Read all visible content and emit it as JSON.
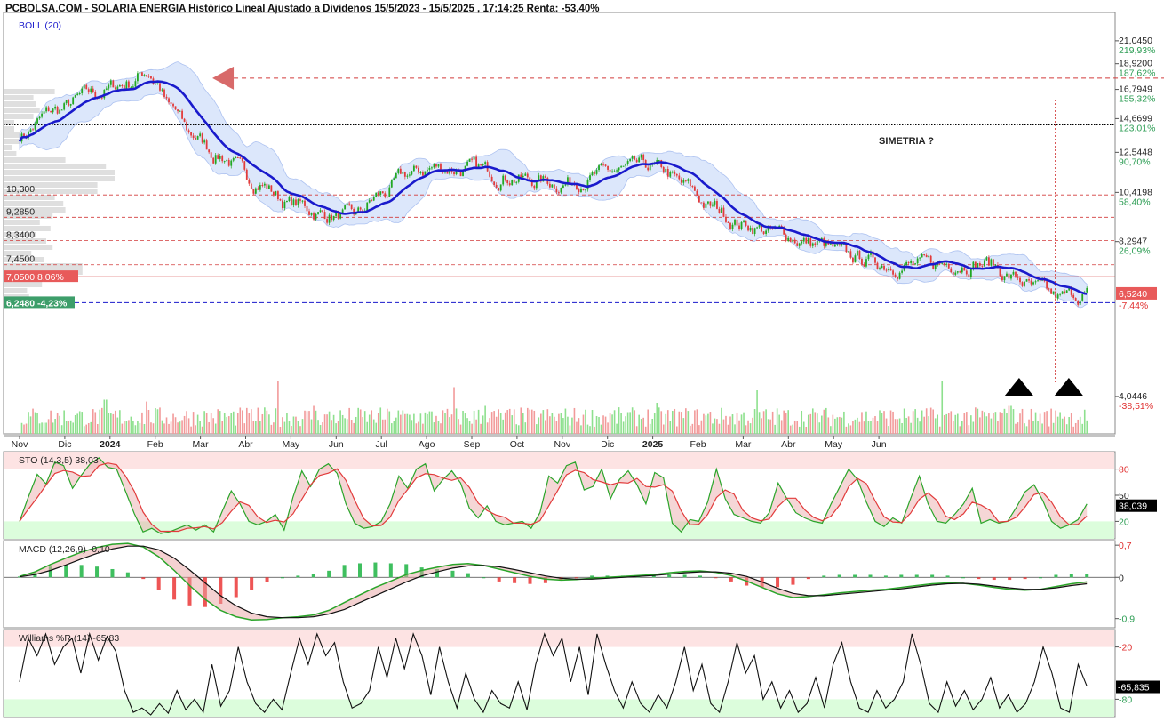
{
  "header": {
    "title": "PCBOLSA.COM - SOLARIA ENERGIA Histórico Lineal Ajustado a Dividenos 15/5/2023 - 15/5/2025 , 17:14:25 Renta: -53,40%"
  },
  "colors": {
    "up": "#22a822",
    "down": "#e23b3b",
    "boll_mid": "#1a1acc",
    "boll_band": "#dbe6fb",
    "overbought_zone": "#fde3e3",
    "oversold_zone": "#dcfddc",
    "badge_red": "#e85a5a",
    "badge_green": "#3d9e6a",
    "arrow": "#e03030"
  },
  "chart_data": [
    {
      "type": "line",
      "name": "price",
      "indicator_label": "BOLL (20)",
      "y_scale": "log",
      "ylim": [
        3.4,
        24.0
      ],
      "x_ticks": [
        "Nov",
        "Dic",
        "2024",
        "Feb",
        "Mar",
        "Abr",
        "May",
        "Jun",
        "Jul",
        "Ago",
        "Sep",
        "Oct",
        "Nov",
        "Dic",
        "2025",
        "Feb",
        "Mar",
        "Abr",
        "May",
        "Jun"
      ],
      "x_tick_bold": [
        "2024",
        "2025"
      ],
      "y_ticks": [
        {
          "price": "21,0450",
          "pct": "219,93%"
        },
        {
          "price": "18,9200",
          "pct": "187,62%"
        },
        {
          "price": "16,7949",
          "pct": "155,32%"
        },
        {
          "price": "14,6699",
          "pct": "123,01%"
        },
        {
          "price": "12,5448",
          "pct": "90,70%"
        },
        {
          "price": "10,4198",
          "pct": "58,40%"
        },
        {
          "price": "8,2947",
          "pct": "26,09%"
        },
        {
          "price": "4,0446",
          "pct": "-38,51%"
        }
      ],
      "y_tick_values": [
        21.045,
        18.92,
        16.7949,
        14.6699,
        12.5448,
        10.4198,
        8.2947,
        4.0446
      ],
      "current_price_label": "6,5240",
      "current_pct_label": "-7,44%",
      "current_price": 6.524,
      "ref_lines": [
        {
          "label": "10,300",
          "value": 10.3
        },
        {
          "label": "9,2850",
          "value": 9.285
        },
        {
          "label": "8,3400",
          "value": 8.34
        },
        {
          "label": "7,4500",
          "value": 7.45
        }
      ],
      "badge_upper": {
        "label": "7,0500  8,06%",
        "value": 7.05
      },
      "badge_lower": {
        "label": "6,2480  -4,23%",
        "value": 6.248
      },
      "black_dotted_line": 14.25,
      "annotation_text": "SIMETRIA ?",
      "anchors": [
        {
          "m": 0,
          "v": 13.6
        },
        {
          "m": 0.8,
          "v": 15.2
        },
        {
          "m": 1.6,
          "v": 16.4
        },
        {
          "m": 2.4,
          "v": 17.3
        },
        {
          "m": 2.85,
          "v": 18.3
        },
        {
          "m": 3.0,
          "v": 17.5
        },
        {
          "m": 3.35,
          "v": 15.3
        },
        {
          "m": 3.8,
          "v": 13.6
        },
        {
          "m": 4.4,
          "v": 12.4
        },
        {
          "m": 5.2,
          "v": 11.0
        },
        {
          "m": 6.0,
          "v": 9.9
        },
        {
          "m": 6.8,
          "v": 9.4
        },
        {
          "m": 7.4,
          "v": 9.3
        },
        {
          "m": 8.0,
          "v": 10.3
        },
        {
          "m": 8.6,
          "v": 11.3
        },
        {
          "m": 9.2,
          "v": 11.7
        },
        {
          "m": 10.0,
          "v": 11.6
        },
        {
          "m": 10.7,
          "v": 11.3
        },
        {
          "m": 11.4,
          "v": 11.0
        },
        {
          "m": 12.0,
          "v": 10.9
        },
        {
          "m": 12.6,
          "v": 11.2
        },
        {
          "m": 13.3,
          "v": 11.5
        },
        {
          "m": 13.8,
          "v": 11.7
        },
        {
          "m": 14.2,
          "v": 11.5
        },
        {
          "m": 14.7,
          "v": 10.7
        },
        {
          "m": 15.3,
          "v": 9.7
        },
        {
          "m": 16.0,
          "v": 9.0
        },
        {
          "m": 16.8,
          "v": 8.6
        },
        {
          "m": 17.6,
          "v": 8.2
        },
        {
          "m": 18.4,
          "v": 7.7
        },
        {
          "m": 19.2,
          "v": 7.5
        },
        {
          "m": 20.0,
          "v": 7.4
        },
        {
          "m": 20.8,
          "v": 7.55
        },
        {
          "m": 21.4,
          "v": 7.5
        },
        {
          "m": 22.0,
          "v": 7.0
        },
        {
          "m": 22.5,
          "v": 6.6
        },
        {
          "m": 23.0,
          "v": 6.35
        },
        {
          "m": 23.4,
          "v": 6.5
        },
        {
          "m": 23.6,
          "v": 6.52
        }
      ],
      "arrows": [
        {
          "direction": "left",
          "m": 4.5,
          "value": 17.7
        },
        {
          "direction": "right",
          "m": 29.7,
          "value": 17.7
        }
      ],
      "arrow_line_from_m": 4.5,
      "arrow_line_to_m": 29.7,
      "vertical_marker_m": 22.9,
      "triangles_m": [
        22.1,
        23.2
      ],
      "volume_spikes": [
        {
          "m": 1.9,
          "h": 0.55
        },
        {
          "m": 2.8,
          "h": 0.52
        },
        {
          "m": 5.7,
          "h": 0.85
        },
        {
          "m": 6.5,
          "h": 0.45
        },
        {
          "m": 7.8,
          "h": 0.38
        },
        {
          "m": 9.6,
          "h": 0.75
        },
        {
          "m": 10.3,
          "h": 0.45
        },
        {
          "m": 14.1,
          "h": 0.5
        },
        {
          "m": 16.3,
          "h": 0.7
        },
        {
          "m": 20.4,
          "h": 0.85
        },
        {
          "m": 21.9,
          "h": 0.45
        },
        {
          "m": 23.0,
          "h": 0.35
        }
      ]
    },
    {
      "type": "line",
      "name": "STO",
      "label": "STO (14,3,5)",
      "value_label": "38,03",
      "current_label": "38,039",
      "current": 38.039,
      "ylim": [
        0,
        100
      ],
      "levels": [
        80,
        50,
        20
      ],
      "level_labels": [
        "80",
        "50",
        "20"
      ],
      "zones": {
        "overbought": [
          80,
          100
        ],
        "oversold": [
          0,
          20
        ]
      },
      "k": [
        20,
        48,
        74,
        63,
        88,
        84,
        58,
        73,
        86,
        93,
        82,
        80,
        55,
        29,
        8,
        12,
        6,
        8,
        12,
        16,
        10,
        16,
        8,
        32,
        55,
        40,
        20,
        16,
        20,
        28,
        10,
        48,
        78,
        60,
        80,
        86,
        75,
        40,
        18,
        12,
        14,
        20,
        40,
        72,
        58,
        80,
        86,
        55,
        68,
        78,
        64,
        35,
        24,
        38,
        20,
        16,
        18,
        20,
        12,
        30,
        72,
        64,
        84,
        88,
        56,
        60,
        80,
        46,
        68,
        78,
        62,
        40,
        76,
        70,
        18,
        8,
        22,
        20,
        42,
        80,
        46,
        28,
        24,
        20,
        18,
        30,
        64,
        46,
        30,
        24,
        20,
        18,
        40,
        60,
        80,
        68,
        42,
        20,
        14,
        24,
        18,
        46,
        72,
        40,
        20,
        18,
        28,
        40,
        58,
        18,
        22,
        18,
        20,
        36,
        54,
        62,
        44,
        20,
        12,
        16,
        22,
        40
      ]
    },
    {
      "type": "line",
      "name": "MACD",
      "label": "MACD (12,26,9)",
      "value_label": "-0,10",
      "ylim": [
        -1.1,
        0.8
      ],
      "ticks": [
        0.7,
        0,
        -0.9
      ],
      "tick_labels": [
        "0,7",
        "0",
        "-0,9"
      ],
      "macd": [
        0.02,
        0.12,
        0.28,
        0.42,
        0.55,
        0.65,
        0.72,
        0.74,
        0.66,
        0.45,
        0.15,
        -0.18,
        -0.48,
        -0.72,
        -0.86,
        -0.93,
        -0.92,
        -0.88,
        -0.86,
        -0.82,
        -0.72,
        -0.55,
        -0.38,
        -0.22,
        -0.08,
        0.06,
        0.15,
        0.22,
        0.28,
        0.3,
        0.26,
        0.18,
        0.1,
        0.02,
        -0.04,
        -0.06,
        -0.05,
        -0.02,
        0.0,
        0.02,
        0.04,
        0.06,
        0.1,
        0.13,
        0.14,
        0.11,
        0.04,
        -0.08,
        -0.22,
        -0.36,
        -0.44,
        -0.42,
        -0.38,
        -0.34,
        -0.31,
        -0.28,
        -0.26,
        -0.22,
        -0.18,
        -0.14,
        -0.12,
        -0.13,
        -0.17,
        -0.22,
        -0.26,
        -0.28,
        -0.26,
        -0.2,
        -0.14,
        -0.1
      ],
      "signal": [
        0.01,
        0.06,
        0.15,
        0.27,
        0.4,
        0.52,
        0.62,
        0.68,
        0.68,
        0.6,
        0.42,
        0.16,
        -0.12,
        -0.4,
        -0.62,
        -0.78,
        -0.86,
        -0.88,
        -0.88,
        -0.86,
        -0.8,
        -0.7,
        -0.55,
        -0.4,
        -0.25,
        -0.1,
        0.03,
        0.12,
        0.2,
        0.25,
        0.26,
        0.23,
        0.17,
        0.1,
        0.03,
        -0.02,
        -0.04,
        -0.04,
        -0.02,
        0.0,
        0.02,
        0.04,
        0.07,
        0.1,
        0.12,
        0.12,
        0.09,
        0.02,
        -0.1,
        -0.24,
        -0.35,
        -0.4,
        -0.4,
        -0.37,
        -0.34,
        -0.31,
        -0.28,
        -0.25,
        -0.21,
        -0.17,
        -0.14,
        -0.13,
        -0.15,
        -0.19,
        -0.23,
        -0.26,
        -0.26,
        -0.23,
        -0.18,
        -0.14
      ]
    },
    {
      "type": "line",
      "name": "Williams %R",
      "label": "Williams %R (14)",
      "value_label": "-65,83",
      "current_label": "-65,835",
      "current": -65.835,
      "ylim": [
        -100,
        0
      ],
      "levels": [
        -20,
        -80
      ],
      "level_labels": [
        "-20",
        "-80"
      ],
      "zones": {
        "overbought": [
          -20,
          0
        ],
        "oversold": [
          -100,
          -80
        ]
      },
      "values": [
        -60,
        -10,
        -30,
        -5,
        -40,
        -20,
        -10,
        -50,
        -5,
        -35,
        -8,
        -25,
        -70,
        -95,
        -90,
        -98,
        -85,
        -96,
        -70,
        -92,
        -80,
        -95,
        -40,
        -88,
        -70,
        -20,
        -60,
        -85,
        -95,
        -80,
        -92,
        -50,
        -10,
        -40,
        -5,
        -30,
        -15,
        -60,
        -90,
        -85,
        -70,
        -20,
        -55,
        -10,
        -45,
        -5,
        -30,
        -75,
        -20,
        -60,
        -90,
        -50,
        -80,
        -95,
        -70,
        -85,
        -90,
        -60,
        -92,
        -40,
        -5,
        -30,
        -10,
        -60,
        -20,
        -75,
        -5,
        -40,
        -70,
        -90,
        -60,
        -85,
        -95,
        -75,
        -90,
        -60,
        -20,
        -70,
        -40,
        -85,
        -95,
        -60,
        -15,
        -50,
        -30,
        -80,
        -60,
        -90,
        -70,
        -95,
        -85,
        -55,
        -90,
        -40,
        -15,
        -60,
        -90,
        -95,
        -70,
        -90,
        -80,
        -60,
        -5,
        -40,
        -85,
        -95,
        -60,
        -88,
        -70,
        -92,
        -80,
        -55,
        -90,
        -75,
        -95,
        -85,
        -60,
        -20,
        -50,
        -90,
        -95,
        -40,
        -65
      ]
    }
  ]
}
